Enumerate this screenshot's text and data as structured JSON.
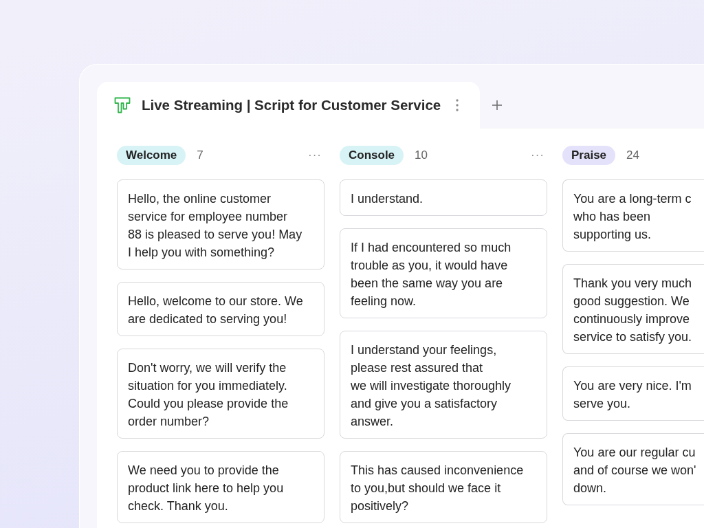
{
  "tab": {
    "title": "Live Streaming | Script for Customer Service",
    "selected": true
  },
  "columns": [
    {
      "tag": "Welcome",
      "color": "#d7f3f6",
      "count": "7",
      "more_menu": "···",
      "cards": [
        {
          "lines": [
            "Hello, the online customer",
            "service for employee number",
            "88 is pleased to serve you! May",
            "I help you with something?"
          ]
        },
        {
          "lines": [
            "Hello, welcome to our store. We",
            "are dedicated to serving you!"
          ]
        },
        {
          "lines": [
            "Don't worry, we will verify the",
            "situation for you immediately.",
            "Could you please provide the",
            "order number?"
          ]
        },
        {
          "lines": [
            "We need you to provide the",
            "product link here to help you",
            "check. Thank you."
          ]
        }
      ]
    },
    {
      "tag": "Console",
      "color": "#d7f3f6",
      "count": "10",
      "more_menu": "···",
      "cards": [
        {
          "lines": [
            "I understand."
          ]
        },
        {
          "lines": [
            "If I had encountered so much",
            "trouble as you, it would have",
            "been the same way you are",
            "feeling now."
          ]
        },
        {
          "lines": [
            "I understand your feelings,",
            "please rest assured that",
            "we will investigate thoroughly",
            "and give you a satisfactory",
            "answer."
          ]
        },
        {
          "lines": [
            "This has caused inconvenience",
            "to you,but should we face it",
            "positively?"
          ]
        }
      ]
    },
    {
      "tag": "Praise",
      "color": "#e4e2fb",
      "count": "24",
      "cards": [
        {
          "lines": [
            "You are a long-term c",
            "who has been",
            "supporting us."
          ]
        },
        {
          "lines": [
            "Thank you very much",
            "good suggestion. We",
            "continuously improve",
            "service to satisfy you."
          ]
        },
        {
          "lines": [
            "You are very nice. I'm",
            "serve you."
          ]
        },
        {
          "lines": [
            "You are our regular cu",
            "and of course we won'",
            "down."
          ]
        }
      ]
    }
  ]
}
